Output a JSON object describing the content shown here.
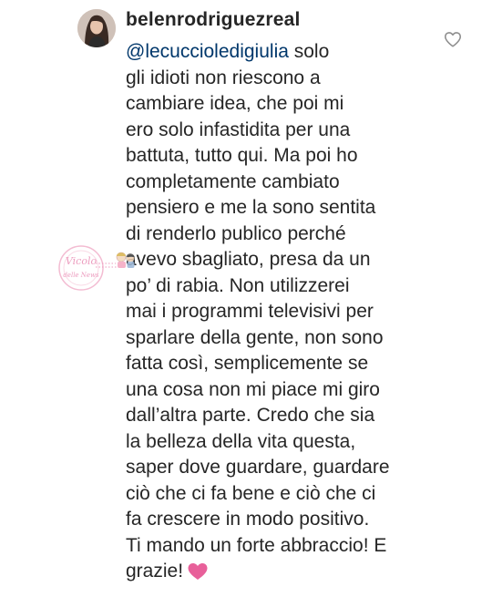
{
  "comment": {
    "username": "belenrodriguezreal",
    "mention": "@lecuccioledigiulia",
    "lines": [
      " solo",
      "gli idioti non riescono a",
      "cambiare idea, che poi mi",
      "ero solo infastidita per una",
      "battuta, tutto qui. Ma poi ho",
      "completamente cambiato",
      "pensiero e me la sono sentita",
      "di renderlo publico perché",
      "avevo sbagliato, presa da un",
      "po’ di rabia. Non utilizzerei",
      "mai i programmi televisivi per",
      "sparlare della gente, non sono",
      "fatta così, semplicemente se",
      "una cosa non mi piace mi giro",
      "dall’altra parte. Credo che sia",
      "la belleza della vita questa,",
      "saper dove guardare, guardare",
      "ciò che ci fa bene e ciò che ci",
      "fa crescere in modo positivo.",
      "Ti mando un forte abbraccio! E",
      "grazie!"
    ],
    "emoji": "pink-heart",
    "like_icon": "heart-outline-icon",
    "colors": {
      "text": "#262626",
      "mention": "#00376b",
      "heart": "#e8609a",
      "icon": "#8e8e8e"
    }
  },
  "watermark": {
    "text_top": "Vicolo",
    "text_bottom": "delle News"
  }
}
